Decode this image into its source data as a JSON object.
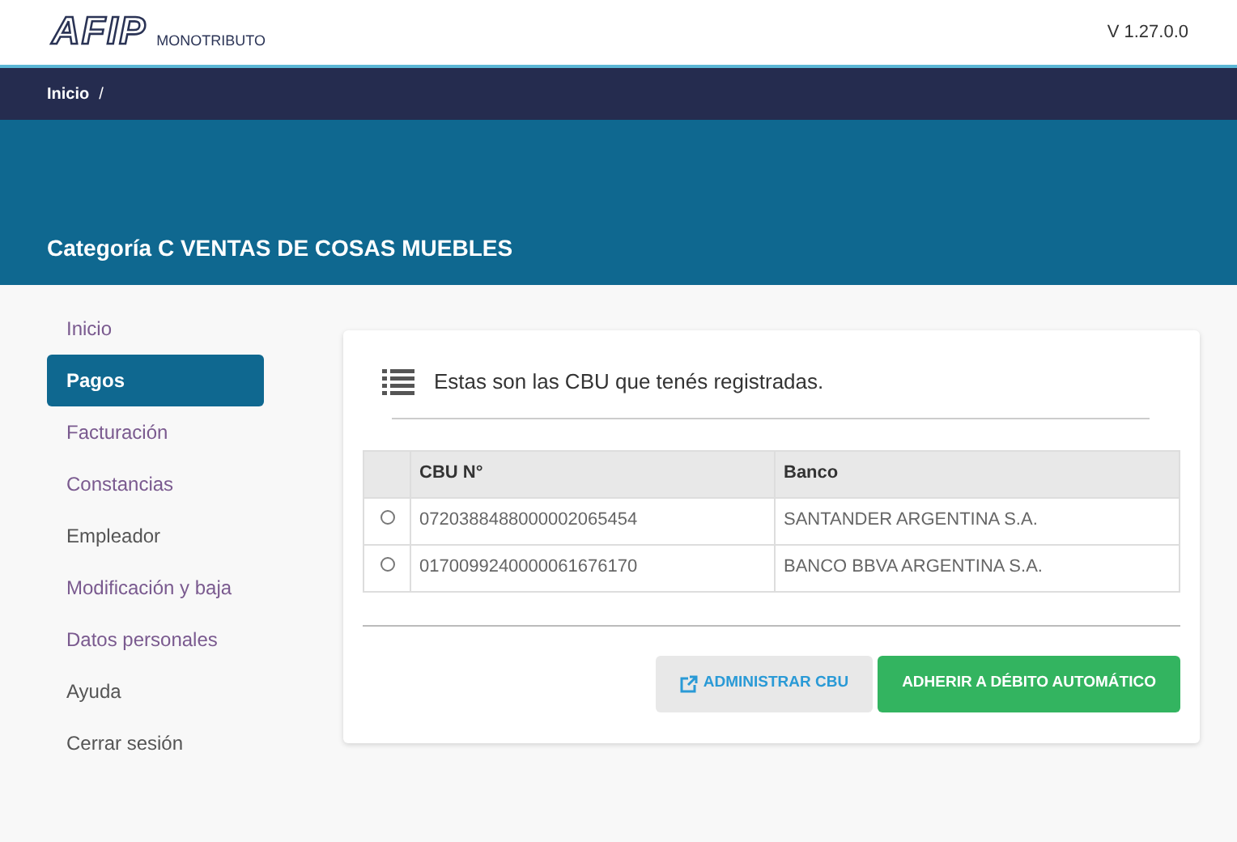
{
  "header": {
    "logo": "AFIP",
    "product": "MONOTRIBUTO",
    "version": "V 1.27.0.0"
  },
  "breadcrumb": [
    "Inicio",
    "/"
  ],
  "banner": {
    "title": "Categoría C VENTAS DE COSAS MUEBLES"
  },
  "sidebar": {
    "items": [
      {
        "label": "Inicio",
        "selected": false,
        "visited": true
      },
      {
        "label": "Pagos",
        "selected": true,
        "visited": false
      },
      {
        "label": "Facturación",
        "selected": false,
        "visited": true
      },
      {
        "label": "Constancias",
        "selected": false,
        "visited": true
      },
      {
        "label": "Empleador",
        "selected": false,
        "visited": false
      },
      {
        "label": "Modificación y baja",
        "selected": false,
        "visited": true
      },
      {
        "label": "Datos personales",
        "selected": false,
        "visited": true
      },
      {
        "label": "Ayuda",
        "selected": false,
        "visited": false
      },
      {
        "label": "Cerrar sesión",
        "selected": false,
        "visited": false
      }
    ]
  },
  "panel": {
    "heading": "Estas son las CBU que tenés registradas.",
    "table": {
      "columns": [
        "CBU N°",
        "Banco"
      ],
      "rows": [
        {
          "cbu": "0720388488000002065454",
          "banco": "SANTANDER ARGENTINA S.A.",
          "selected": false
        },
        {
          "cbu": "0170099240000061676170",
          "banco": "BANCO BBVA ARGENTINA S.A.",
          "selected": false
        }
      ]
    },
    "buttons": [
      {
        "label": "ADMINISTRAR CBU",
        "kind": "secondary"
      },
      {
        "label": "ADHERIR A DÉBITO AUTOMÁTICO",
        "kind": "primary"
      }
    ]
  }
}
